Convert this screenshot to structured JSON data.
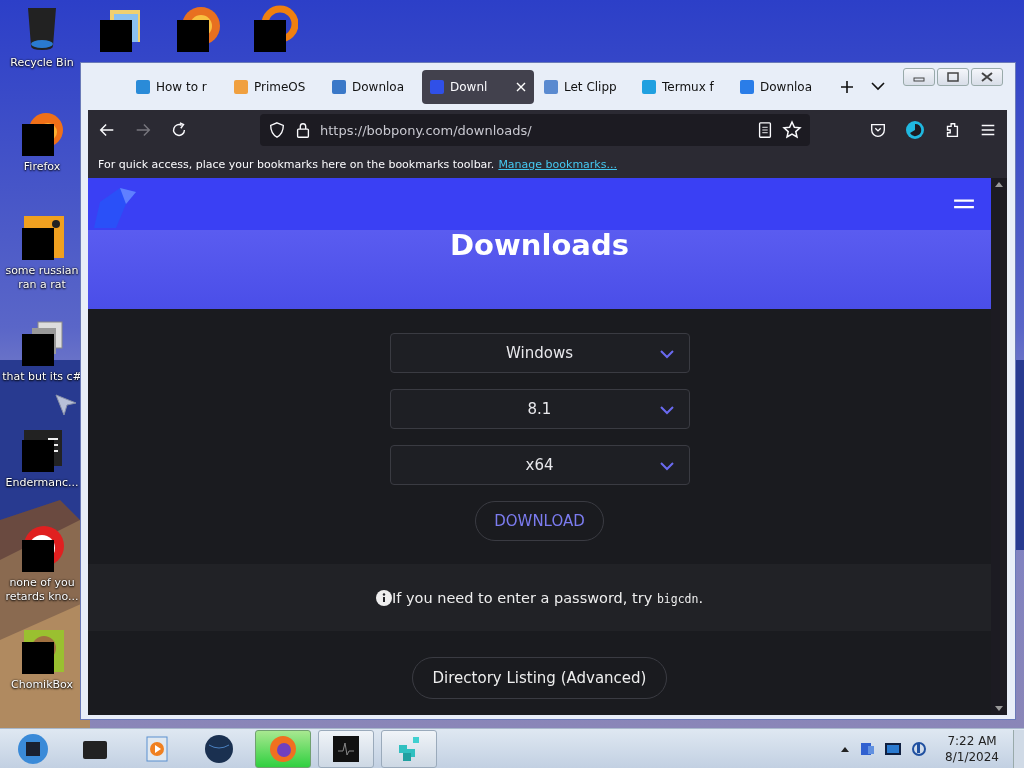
{
  "desktop_icons": [
    {
      "label": "Recycle Bin",
      "kind": "bin"
    },
    {
      "kind": "folder"
    },
    {
      "kind": "orb"
    },
    {
      "kind": "ring"
    },
    {
      "label": "Firefox",
      "kind": "firefox"
    },
    {
      "label": "some russian ran a rat",
      "kind": "app"
    },
    {
      "label": "that but its c#",
      "kind": "stack"
    },
    {
      "label": "Endermanc...",
      "kind": "terminal"
    },
    {
      "label": "none of you retards kno...",
      "kind": "bird"
    },
    {
      "label": "ChomikBox",
      "kind": "hamster"
    }
  ],
  "browser": {
    "tabs": [
      {
        "label": "How to r",
        "selected": false,
        "color": "#2a8bd8"
      },
      {
        "label": "PrimeOS",
        "selected": false,
        "color": "#f0a040"
      },
      {
        "label": "Downloa",
        "selected": false,
        "color": "#3a78c8"
      },
      {
        "label": "Downl",
        "selected": true,
        "color": "#3050e8"
      },
      {
        "label": "Let Clipp",
        "selected": false,
        "color": "#5a8ad0"
      },
      {
        "label": "Termux f",
        "selected": false,
        "color": "#20a0e0"
      },
      {
        "label": "Downloa",
        "selected": false,
        "color": "#2a7de8"
      }
    ],
    "url": "https://bobpony.com/downloads/",
    "bookmarks_bar": {
      "message": "For quick access, place your bookmarks here on the bookmarks toolbar.",
      "link": "Manage bookmarks..."
    }
  },
  "page": {
    "title": "Downloads",
    "selects": [
      "Windows",
      "8.1",
      "x64"
    ],
    "download_button": "DOWNLOAD",
    "notice": {
      "text": "If you need to enter a password, try",
      "code": "bigcdn",
      "end": "."
    },
    "directory_button": "Directory Listing (Advanced)"
  },
  "taskbar": {
    "items": [
      {
        "kind": "start",
        "running": false,
        "selected": false
      },
      {
        "kind": "box",
        "running": false,
        "selected": false
      },
      {
        "kind": "media",
        "running": false,
        "selected": false
      },
      {
        "kind": "globe",
        "running": false,
        "selected": false
      },
      {
        "kind": "firefox",
        "running": true,
        "selected": true
      },
      {
        "kind": "monitor",
        "running": true,
        "selected": false
      },
      {
        "kind": "cubes",
        "running": true,
        "selected": false
      }
    ],
    "clock": {
      "time": "7:22 AM",
      "date": "8/1/2024"
    }
  }
}
